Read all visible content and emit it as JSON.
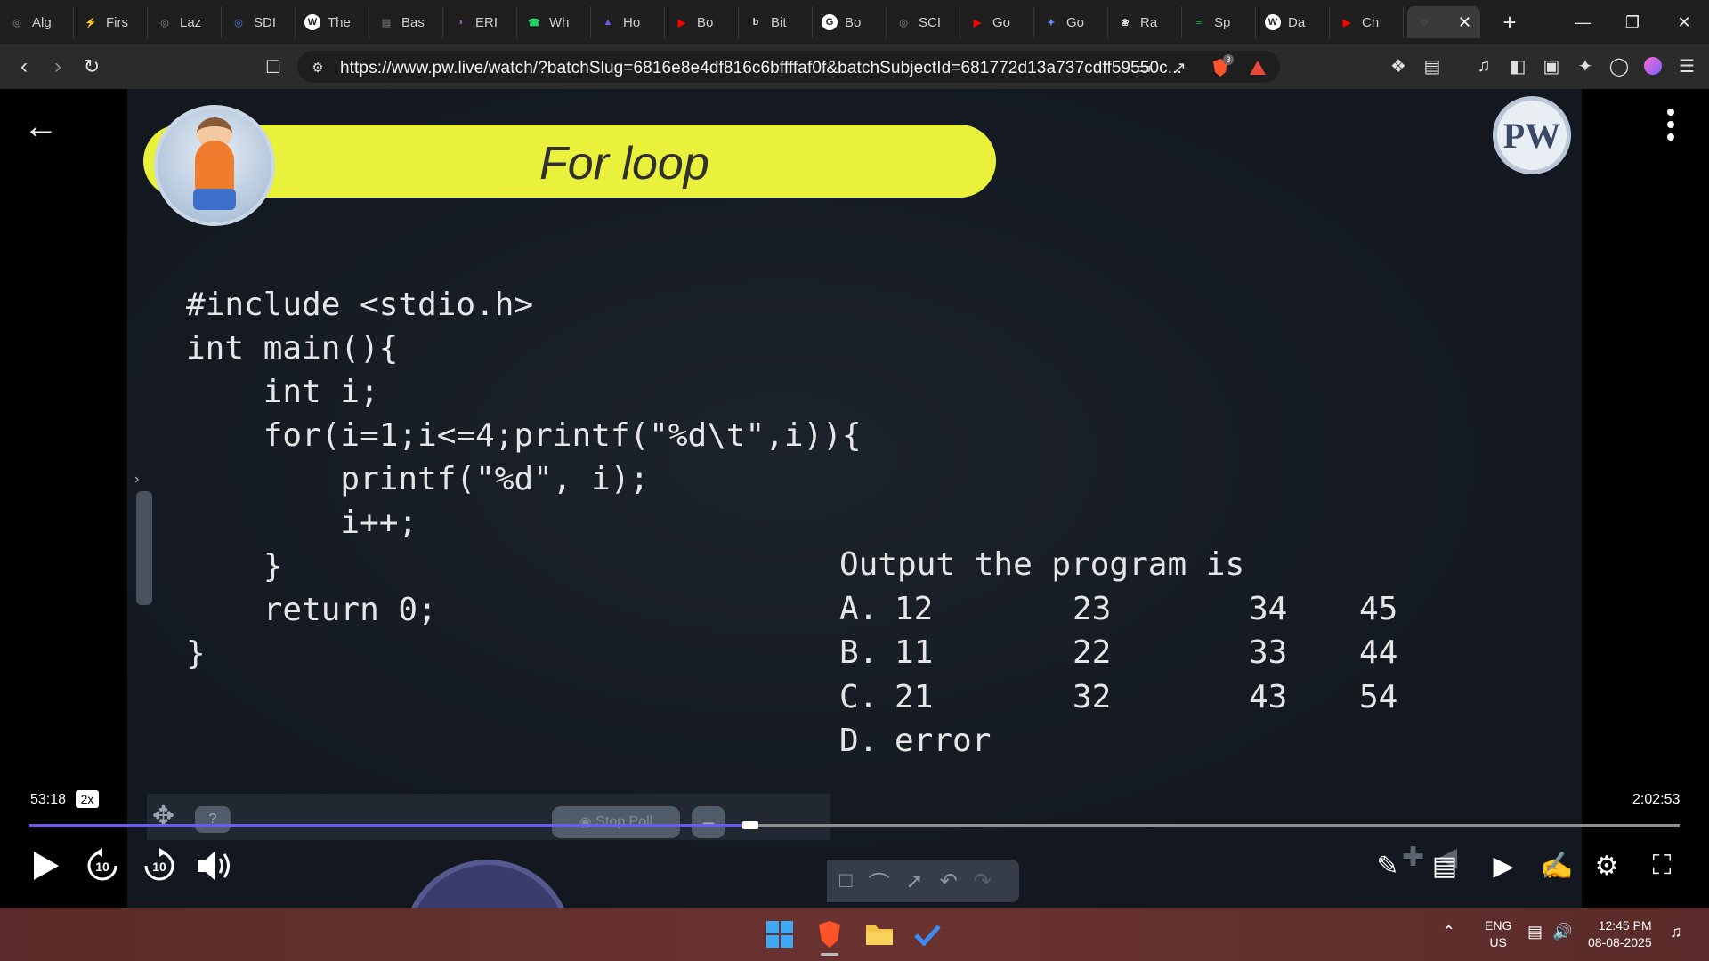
{
  "browser": {
    "tabs": [
      {
        "label": "Alg",
        "icon": "globe-icon",
        "color": "#5f6368"
      },
      {
        "label": "Firs",
        "icon": "lightning-icon",
        "color": "#f4b400"
      },
      {
        "label": "Laz",
        "icon": "globe-icon",
        "color": "#5f6368"
      },
      {
        "label": "SDI",
        "icon": "globe-icon",
        "color": "#3c5a99"
      },
      {
        "label": "The",
        "icon": "w3schools-icon",
        "color": "#ffffff"
      },
      {
        "label": "Bas",
        "icon": "page-icon",
        "color": "#5f6368"
      },
      {
        "label": "ERI",
        "icon": "brain-icon",
        "color": "#9b59b6"
      },
      {
        "label": "Wh",
        "icon": "whatsapp-icon",
        "color": "#25d366"
      },
      {
        "label": "Ho",
        "icon": "bookmark-icon",
        "color": "#6a5cf0"
      },
      {
        "label": "Bo",
        "icon": "youtube-icon",
        "color": "#ff0000"
      },
      {
        "label": "Bit",
        "icon": "bitly-icon",
        "color": "#e0e0e0"
      },
      {
        "label": "Bo",
        "icon": "google-icon",
        "color": "#ffffff"
      },
      {
        "label": "SCI",
        "icon": "globe-icon",
        "color": "#5f6368"
      },
      {
        "label": "Go",
        "icon": "youtube-icon",
        "color": "#ff0000"
      },
      {
        "label": "Go",
        "icon": "gemini-icon",
        "color": "#6a8df7"
      },
      {
        "label": "Ra",
        "icon": "openai-icon",
        "color": "#e0e0e0"
      },
      {
        "label": "Sp",
        "icon": "spotify-icon",
        "color": "#1db954"
      },
      {
        "label": "Da",
        "icon": "wikipedia-icon",
        "color": "#ffffff"
      },
      {
        "label": "Ch",
        "icon": "youtube-icon",
        "color": "#ff0000"
      }
    ],
    "url": "https://www.pw.live/watch/?batchSlug=6816e8e4df816c6bffffaf0f&batchSubjectId=681772d13a737cdff59550c...",
    "brave_badge": "3"
  },
  "slide": {
    "title": "For loop",
    "logo_text": "PW",
    "code_lines": [
      "#include <stdio.h>",
      "int main(){",
      "    int i;",
      "    for(i=1;i<=4;printf(\"%d\\t\",i)){",
      "        printf(\"%d\", i);",
      "        i++;",
      "    }",
      "    return 0;",
      "}"
    ],
    "question": "Output the program is",
    "options": [
      {
        "label": "A.",
        "values": [
          "12",
          "23",
          "34",
          "45"
        ]
      },
      {
        "label": "B.",
        "values": [
          "11",
          "22",
          "33",
          "44"
        ]
      },
      {
        "label": "C.",
        "values": [
          "21",
          "32",
          "43",
          "54"
        ]
      },
      {
        "label": "D.",
        "values": [
          "error"
        ]
      }
    ],
    "stop_poll_label": "Stop Poll",
    "help_label": "?"
  },
  "player": {
    "current_time": "53:18",
    "speed": "2x",
    "total_time": "2:02:53",
    "progress_fraction": 0.434,
    "skip_back": "10",
    "skip_forward": "10"
  },
  "taskbar": {
    "lang_line1": "ENG",
    "lang_line2": "US",
    "time": "12:45 PM",
    "date": "08-08-2025"
  },
  "colors": {
    "accent_progress": "#6a5cf0",
    "banner": "#e9f13b",
    "taskbar": "#6a3331"
  }
}
